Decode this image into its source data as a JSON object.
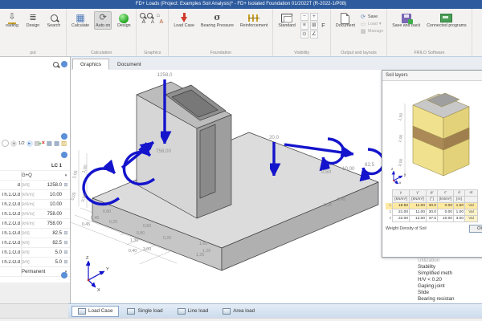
{
  "title_bar": {
    "title": "FD+ Loads (Project: Examples Soil Analysis)* - FD+ Isolated Foundation 01/2022T (R-2022-1/P08)"
  },
  "icons": {
    "loading": "⇩",
    "design_list": "≣",
    "calculate": "▦",
    "auto_on": "⟳",
    "zoom_home": "⌂",
    "font_a1": "A",
    "font_a2": "A",
    "font_a3": "A",
    "caret": "▾",
    "vis_minus": "−",
    "vis_plus": "+",
    "vis_layers": "≡",
    "vis_box": "⊞",
    "vis_f": "F",
    "vis_gear": "⊙",
    "vis_angle": "∠",
    "save_round": "⟳",
    "load_folder": "▭",
    "manage_box": "▩",
    "nav_prev": "◄",
    "nav_next": "►",
    "add_doc": "▤",
    "add_plus": "+",
    "delete_x": "×",
    "table1": "▦",
    "table2": "▦",
    "broom": "▨",
    "grid_small": "⊞",
    "chevron_up": "ˆ",
    "minimize": "—"
  },
  "ribbon": {
    "groups": {
      "input": {
        "label": "put",
        "b1": "oading",
        "b2": "Design",
        "b3": "Search"
      },
      "calculation": {
        "label": "Calculation",
        "b1": "Calculate",
        "b2": "Auto on",
        "b3": "Design"
      },
      "graphics": {
        "label": "Graphics"
      },
      "foundation": {
        "label": "Foundation",
        "b1": "Load Case",
        "b2": "Bearing Pressure",
        "b3": "Reinforcement"
      },
      "visibility": {
        "label": "Visibility",
        "b1": "Standard"
      },
      "output": {
        "label": "Output and layouts",
        "b1": "Document",
        "r1": "Save",
        "r2": "Load",
        "r3": "Manage"
      },
      "frilo": {
        "label": "FRILO Software",
        "b1": "Save and back",
        "b2": "Connected programs"
      }
    }
  },
  "doc_tabs": {
    "t1": "Graphics",
    "t2": "Document"
  },
  "left_panel": {
    "pager": "1/2",
    "lc_header": "LC 1",
    "combination": "G+Q",
    "rows": [
      {
        "label": "d",
        "unit": "[kN]",
        "value": "1258.0"
      },
      {
        "label": "Th.1.O.d",
        "unit": "[kN/m]",
        "value": "10.00"
      },
      {
        "label": "Th.2.O.d",
        "unit": "[kN/m]",
        "value": "10.00"
      },
      {
        "label": "Th.1.O.d",
        "unit": "[kN/m]",
        "value": "758.00"
      },
      {
        "label": "Th.2.O.d",
        "unit": "[kN/m]",
        "value": "758.00"
      },
      {
        "label": "Th.1.O.d",
        "unit": "[kN]",
        "value": "82.5"
      },
      {
        "label": "Th.2.O.d",
        "unit": "[kN]",
        "value": "82.5"
      },
      {
        "label": "Th.1.O.d",
        "unit": "[kN]",
        "value": "5.0"
      },
      {
        "label": "Th.2.O.d",
        "unit": "[kN]",
        "value": "5.0"
      }
    ],
    "bottom_row": "Permanent"
  },
  "graphics": {
    "loads": {
      "vertical": "1258,0",
      "area": "20,0",
      "axial": "758,00",
      "ecc": "0,50",
      "torsion": "10,00",
      "moment": "82,5"
    },
    "dims_bottom": [
      "0,80",
      "0,45",
      "0,45",
      "0,25",
      "0,60",
      "0,80",
      "1,30",
      "0,25",
      "1,60",
      "0,40",
      "3,00",
      "1,25",
      "1,25",
      "0,25",
      "0,45"
    ],
    "dims_left": [
      "1,05",
      "1,00",
      "0,05",
      "0,50"
    ],
    "axes": {
      "x": "X",
      "y": "Y",
      "z": "Z"
    }
  },
  "soil_panel": {
    "title": "Soil layers",
    "dims": [
      "1,50",
      "1,00",
      "3,00"
    ],
    "axes": {
      "x": "x",
      "y": "y",
      "z": "z"
    },
    "table": {
      "h": [
        "γ",
        "γ'",
        "φ'",
        "c'",
        "d",
        "ot"
      ],
      "u": [
        "[kN/m³]",
        "[kN/m³]",
        "[°]",
        "[kN/m²]",
        "[m]",
        ""
      ],
      "rows": [
        [
          "1",
          "18.50",
          "11.00",
          "30.0",
          "0.00",
          "1.50",
          "Val"
        ],
        [
          "2",
          "21.00",
          "11.00",
          "30.0",
          "0.00",
          "1.00",
          "Val"
        ],
        [
          "3",
          "22.00",
          "12.00",
          "37.5",
          "10.00",
          "3.00",
          "Val"
        ]
      ]
    },
    "footer": "Weight Density of Soil",
    "ok_label": "OK"
  },
  "results": {
    "heading": "Utilization",
    "lines": [
      "Stability",
      "Simplified meth",
      "H/V < 0.20",
      "Gaping joint",
      "Slide",
      "Bearing resistan"
    ]
  },
  "bottom_tabs": [
    "Load Case",
    "Single load",
    "Line load",
    "Area load"
  ],
  "colors": {
    "accent_blue": "#2d5b9e",
    "load_arrow": "#1414cc",
    "soil_yellow": "#f0e18e",
    "soil_brown": "#ab8a58",
    "highlight_row": "#ffe9a0"
  }
}
